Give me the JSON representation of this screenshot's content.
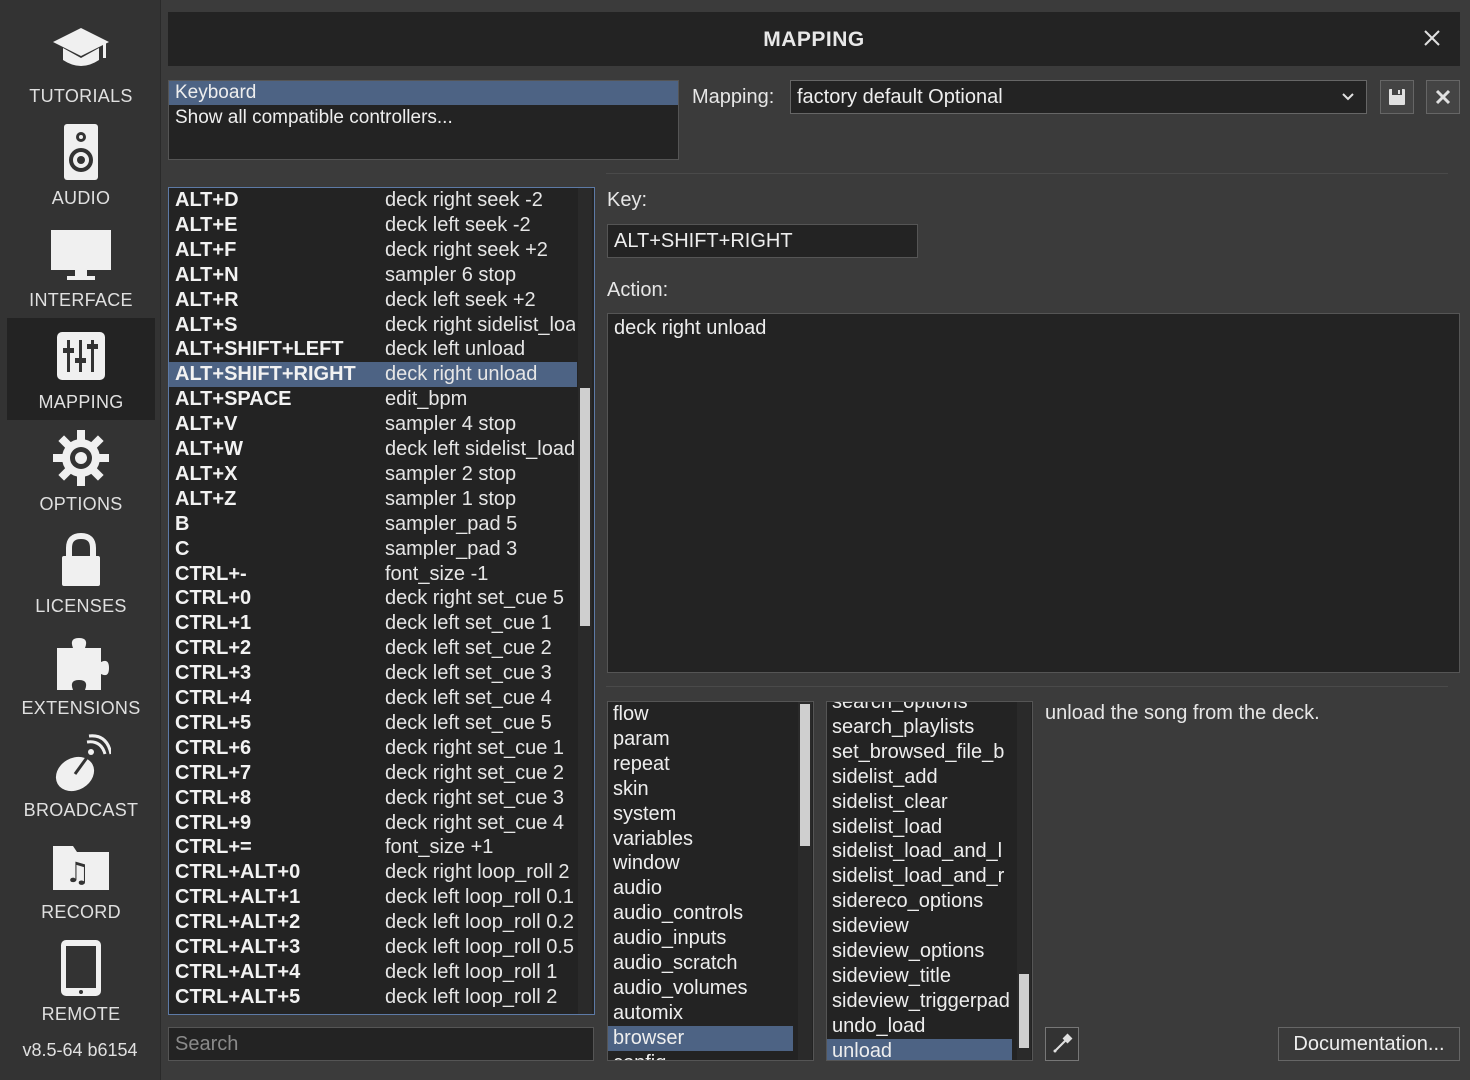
{
  "sidebar": {
    "items": [
      {
        "label": "TUTORIALS",
        "icon": "graduation-cap-icon"
      },
      {
        "label": "AUDIO",
        "icon": "speaker-icon"
      },
      {
        "label": "INTERFACE",
        "icon": "monitor-icon"
      },
      {
        "label": "MAPPING",
        "icon": "sliders-icon",
        "active": true
      },
      {
        "label": "OPTIONS",
        "icon": "gear-icon"
      },
      {
        "label": "LICENSES",
        "icon": "lock-icon"
      },
      {
        "label": "EXTENSIONS",
        "icon": "puzzle-icon"
      },
      {
        "label": "BROADCAST",
        "icon": "satellite-dish-icon"
      },
      {
        "label": "RECORD",
        "icon": "music-folder-icon"
      },
      {
        "label": "REMOTE",
        "icon": "tablet-icon"
      }
    ],
    "version": "v8.5-64 b6154"
  },
  "window": {
    "title": "MAPPING"
  },
  "controllers": {
    "items": [
      "Keyboard",
      "Show all compatible controllers..."
    ],
    "selected_index": 0
  },
  "mapping": {
    "label": "Mapping:",
    "value": "factory default Optional"
  },
  "key_list": {
    "rows": [
      {
        "key": "ALT+D",
        "action": "deck right seek -2"
      },
      {
        "key": "ALT+E",
        "action": "deck left seek -2"
      },
      {
        "key": "ALT+F",
        "action": "deck right seek +2"
      },
      {
        "key": "ALT+N",
        "action": "sampler 6 stop"
      },
      {
        "key": "ALT+R",
        "action": "deck left seek +2"
      },
      {
        "key": "ALT+S",
        "action": "deck right sidelist_load"
      },
      {
        "key": "ALT+SHIFT+LEFT",
        "action": "deck left unload"
      },
      {
        "key": "ALT+SHIFT+RIGHT",
        "action": "deck right unload"
      },
      {
        "key": "ALT+SPACE",
        "action": "edit_bpm"
      },
      {
        "key": "ALT+V",
        "action": "sampler 4 stop"
      },
      {
        "key": "ALT+W",
        "action": "deck left sidelist_load"
      },
      {
        "key": "ALT+X",
        "action": "sampler 2 stop"
      },
      {
        "key": "ALT+Z",
        "action": "sampler 1 stop"
      },
      {
        "key": "B",
        "action": "sampler_pad 5"
      },
      {
        "key": "C",
        "action": "sampler_pad 3"
      },
      {
        "key": "CTRL+-",
        "action": "font_size -1"
      },
      {
        "key": "CTRL+0",
        "action": "deck right set_cue 5"
      },
      {
        "key": "CTRL+1",
        "action": "deck left set_cue 1"
      },
      {
        "key": "CTRL+2",
        "action": "deck left set_cue 2"
      },
      {
        "key": "CTRL+3",
        "action": "deck left set_cue 3"
      },
      {
        "key": "CTRL+4",
        "action": "deck left set_cue 4"
      },
      {
        "key": "CTRL+5",
        "action": "deck left set_cue 5"
      },
      {
        "key": "CTRL+6",
        "action": "deck right set_cue 1"
      },
      {
        "key": "CTRL+7",
        "action": "deck right set_cue 2"
      },
      {
        "key": "CTRL+8",
        "action": "deck right set_cue 3"
      },
      {
        "key": "CTRL+9",
        "action": "deck right set_cue 4"
      },
      {
        "key": "CTRL+=",
        "action": "font_size +1"
      },
      {
        "key": "CTRL+ALT+0",
        "action": "deck right loop_roll 2"
      },
      {
        "key": "CTRL+ALT+1",
        "action": "deck left loop_roll 0.1"
      },
      {
        "key": "CTRL+ALT+2",
        "action": "deck left loop_roll 0.2"
      },
      {
        "key": "CTRL+ALT+3",
        "action": "deck left loop_roll 0.5"
      },
      {
        "key": "CTRL+ALT+4",
        "action": "deck left loop_roll 1"
      },
      {
        "key": "CTRL+ALT+5",
        "action": "deck left loop_roll 2"
      }
    ],
    "selected_index": 7
  },
  "search": {
    "placeholder": "Search"
  },
  "editor": {
    "key_label": "Key:",
    "key_value": "ALT+SHIFT+RIGHT",
    "action_label": "Action:",
    "action_value": "deck right unload"
  },
  "categories": {
    "items": [
      "flow",
      "param",
      "repeat",
      "skin",
      "system",
      "variables",
      "window",
      "audio",
      "audio_controls",
      "audio_inputs",
      "audio_scratch",
      "audio_volumes",
      "automix",
      "browser",
      "config"
    ],
    "selected_index": 13
  },
  "verbs": {
    "items": [
      "search_options",
      "search_playlists",
      "set_browsed_file_b",
      "sidelist_add",
      "sidelist_clear",
      "sidelist_load",
      "sidelist_load_and_l",
      "sidelist_load_and_r",
      "sidereco_options",
      "sideview",
      "sideview_options",
      "sideview_title",
      "sideview_triggerpad",
      "undo_load",
      "unload"
    ],
    "selected_index": 14
  },
  "description": "unload the song from the deck.",
  "documentation_button": "Documentation..."
}
